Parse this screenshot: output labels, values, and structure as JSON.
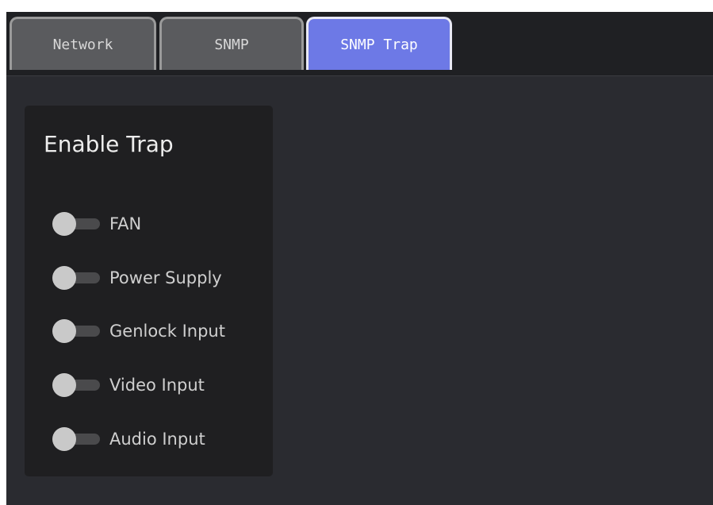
{
  "tabs": [
    {
      "label": "Network",
      "active": false
    },
    {
      "label": "SNMP",
      "active": false
    },
    {
      "label": "SNMP Trap",
      "active": true
    }
  ],
  "panel": {
    "title": "Enable Trap",
    "toggles": [
      {
        "label": "FAN",
        "enabled": false
      },
      {
        "label": "Power Supply",
        "enabled": false
      },
      {
        "label": "Genlock Input",
        "enabled": false
      },
      {
        "label": "Video Input",
        "enabled": false
      },
      {
        "label": "Audio Input",
        "enabled": false
      }
    ]
  },
  "colors": {
    "active_tab": "#6d79e6",
    "inactive_tab": "#5a5b5e",
    "background": "#2a2b30",
    "panel": "#1f1f21"
  }
}
